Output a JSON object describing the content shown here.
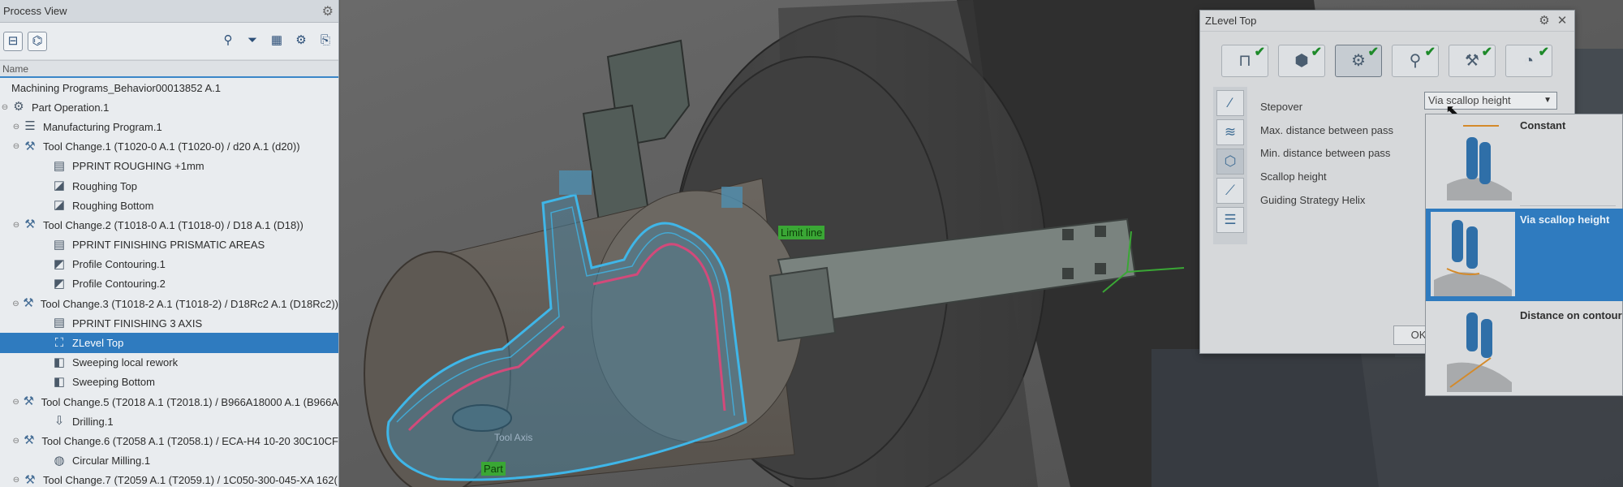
{
  "process_view": {
    "title": "Process View",
    "column_header": "Name",
    "tree": [
      {
        "label": "Machining Programs_Behavior00013852 A.1",
        "level": 0,
        "icon": "",
        "selected": false
      },
      {
        "label": "Part Operation.1",
        "level": 1,
        "icon": "part-operation-icon",
        "selected": false
      },
      {
        "label": "Manufacturing Program.1",
        "level": 2,
        "icon": "program-icon",
        "selected": false
      },
      {
        "label": "Tool Change.1 (T1020-0 A.1 (T1020-0) / d20 A.1 (d20))",
        "level": 3,
        "icon": "tool-change-icon",
        "selected": false
      },
      {
        "label": "PPRINT ROUGHING +1mm",
        "level": 4,
        "icon": "pprint-icon",
        "selected": false
      },
      {
        "label": "Roughing Top",
        "level": 4,
        "icon": "roughing-icon",
        "selected": false
      },
      {
        "label": "Roughing Bottom",
        "level": 4,
        "icon": "roughing-icon",
        "selected": false
      },
      {
        "label": "Tool Change.2 (T1018-0 A.1 (T1018-0) / D18 A.1 (D18))",
        "level": 3,
        "icon": "tool-change-icon",
        "selected": false
      },
      {
        "label": "PPRINT FINISHING PRISMATIC AREAS",
        "level": 4,
        "icon": "pprint-icon",
        "selected": false
      },
      {
        "label": "Profile Contouring.1",
        "level": 4,
        "icon": "profile-contouring-icon",
        "selected": false
      },
      {
        "label": "Profile Contouring.2",
        "level": 4,
        "icon": "profile-contouring-icon",
        "selected": false
      },
      {
        "label": "Tool Change.3 (T1018-2 A.1 (T1018-2) / D18Rc2 A.1 (D18Rc2))",
        "level": 3,
        "icon": "tool-change-icon",
        "selected": false
      },
      {
        "label": "PPRINT FINISHING 3 AXIS",
        "level": 4,
        "icon": "pprint-icon",
        "selected": false
      },
      {
        "label": "ZLevel Top",
        "level": 4,
        "icon": "zlevel-icon",
        "selected": true
      },
      {
        "label": "Sweeping local rework",
        "level": 4,
        "icon": "sweeping-icon",
        "selected": false
      },
      {
        "label": "Sweeping Bottom",
        "level": 4,
        "icon": "sweeping-icon",
        "selected": false
      },
      {
        "label": "Tool Change.5 (T2018 A.1 (T2018.1) / B966A18000 A.1 (B966A",
        "level": 3,
        "icon": "tool-change-icon",
        "selected": false
      },
      {
        "label": "Drilling.1",
        "level": 4,
        "icon": "drilling-icon",
        "selected": false
      },
      {
        "label": "Tool Change.6 (T2058 A.1 (T2058.1) / ECA-H4 10-20 30C10CF",
        "level": 3,
        "icon": "tool-change-icon",
        "selected": false
      },
      {
        "label": "Circular Milling.1",
        "level": 4,
        "icon": "circular-milling-icon",
        "selected": false
      },
      {
        "label": "Tool Change.7 (T2059 A.1 (T2059.1) / 1C050-300-045-XA 162(",
        "level": 3,
        "icon": "tool-change-icon",
        "selected": false
      }
    ]
  },
  "viewport": {
    "label_limit_line": "Limit line",
    "label_part": "Part",
    "label_tool_axis": "Tool Axis"
  },
  "dialog": {
    "title": "ZLevel Top",
    "params": [
      "Stepover",
      "Max. distance between pass",
      "Min. distance between pass",
      "Scallop height",
      "Guiding Strategy Helix"
    ],
    "stepover_value": "Via scallop height",
    "ok_label": "OK",
    "tabs": [
      {
        "icon": "geometry-tab-icon",
        "checked": true
      },
      {
        "icon": "part-tab-icon",
        "checked": true
      },
      {
        "icon": "strategy-tab-icon",
        "checked": true
      },
      {
        "icon": "tool-tab-icon",
        "checked": true
      },
      {
        "icon": "feeds-tab-icon",
        "checked": true
      },
      {
        "icon": "speed-tab-icon",
        "checked": true
      }
    ]
  },
  "dropdown": {
    "options": [
      {
        "label": "Constant",
        "selected": false
      },
      {
        "label": "Via scallop height",
        "selected": true
      },
      {
        "label": "Distance on contour",
        "selected": false
      }
    ]
  },
  "colors": {
    "selection": "#2f7bbf",
    "toolpath": "#3fb6e8",
    "limit_label_bg": "#3aa735",
    "check": "#1e8a2a"
  }
}
